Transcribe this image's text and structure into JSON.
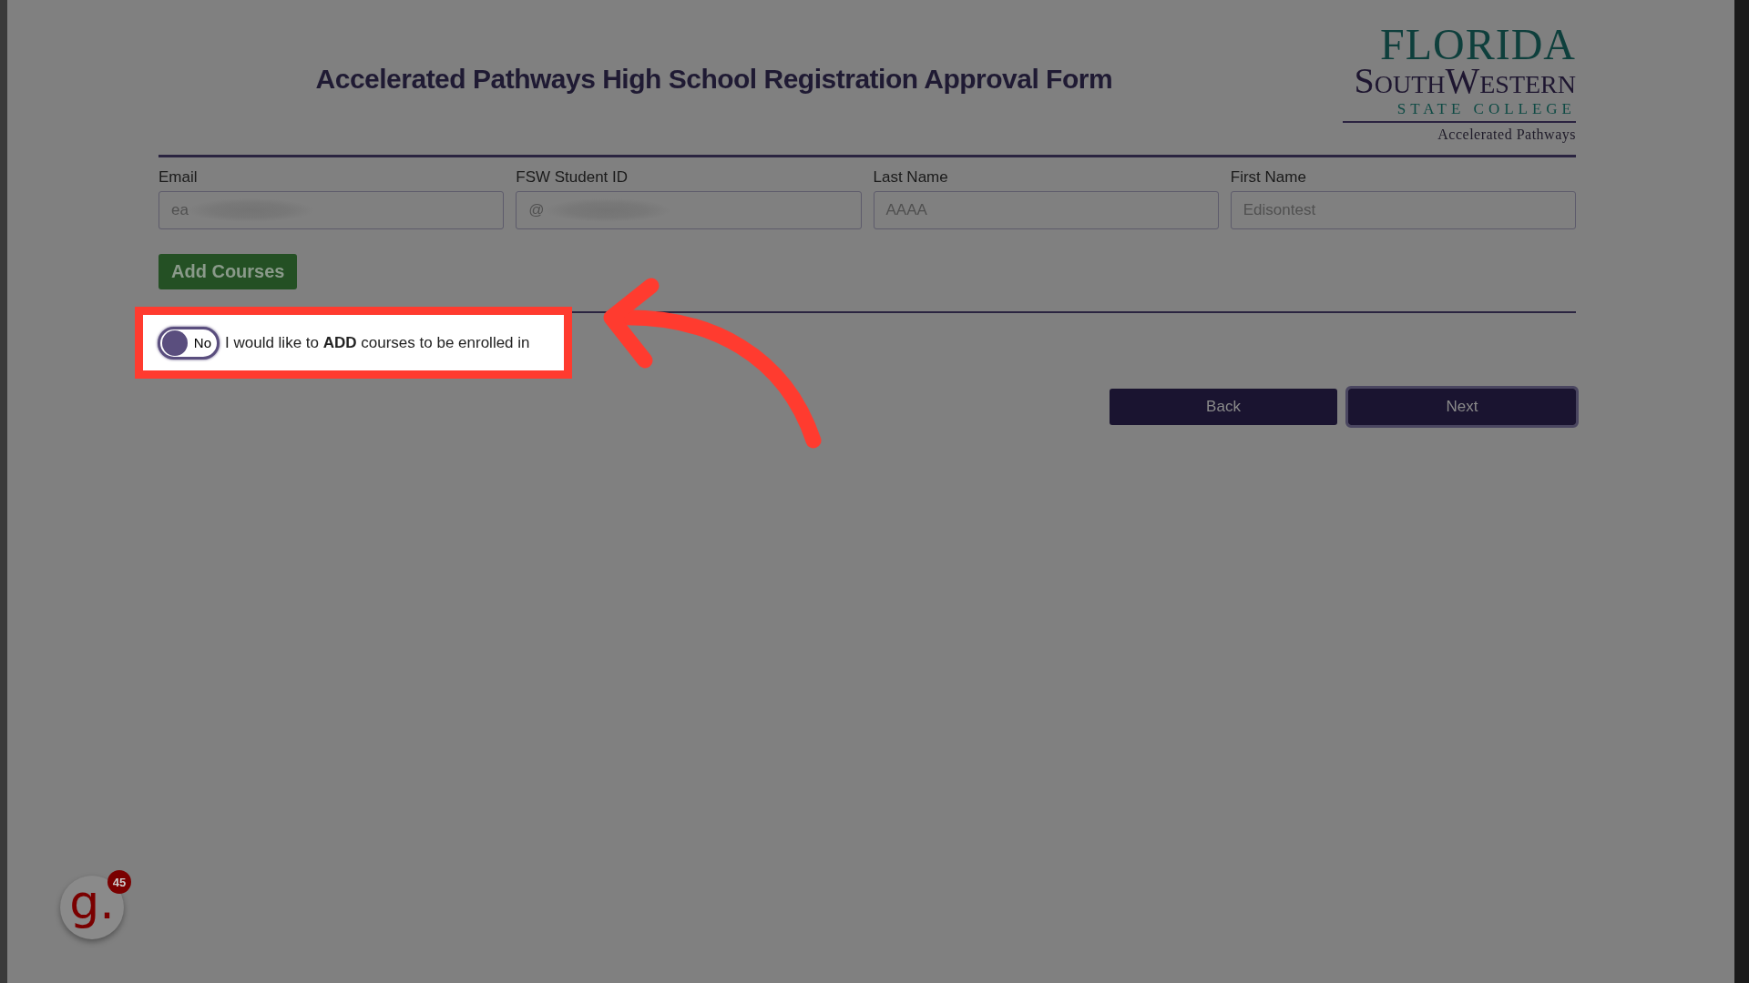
{
  "header": {
    "title": "Accelerated Pathways High School Registration Approval Form",
    "logo": {
      "line_1": "FLORIDA",
      "line_2": "SouthWestern",
      "line_3": "STATE COLLEGE",
      "line_4": "Accelerated Pathways"
    }
  },
  "fields": [
    {
      "label": "Email",
      "value": "ea",
      "redacted": true
    },
    {
      "label": "FSW Student ID",
      "value": "@",
      "redacted": true
    },
    {
      "label": "Last Name",
      "value": "AAAA",
      "redacted": false
    },
    {
      "label": "First Name",
      "value": "Edisontest",
      "redacted": false
    }
  ],
  "add_button": "Add Courses",
  "toggle": {
    "state_label": "No",
    "checked": false,
    "label": "I would like to **ADD** courses to be enrolled in",
    "highlighted": true
  },
  "buttons": [
    "Back",
    "Next"
  ],
  "help_badge": {
    "letter": "g.",
    "count": "45"
  }
}
